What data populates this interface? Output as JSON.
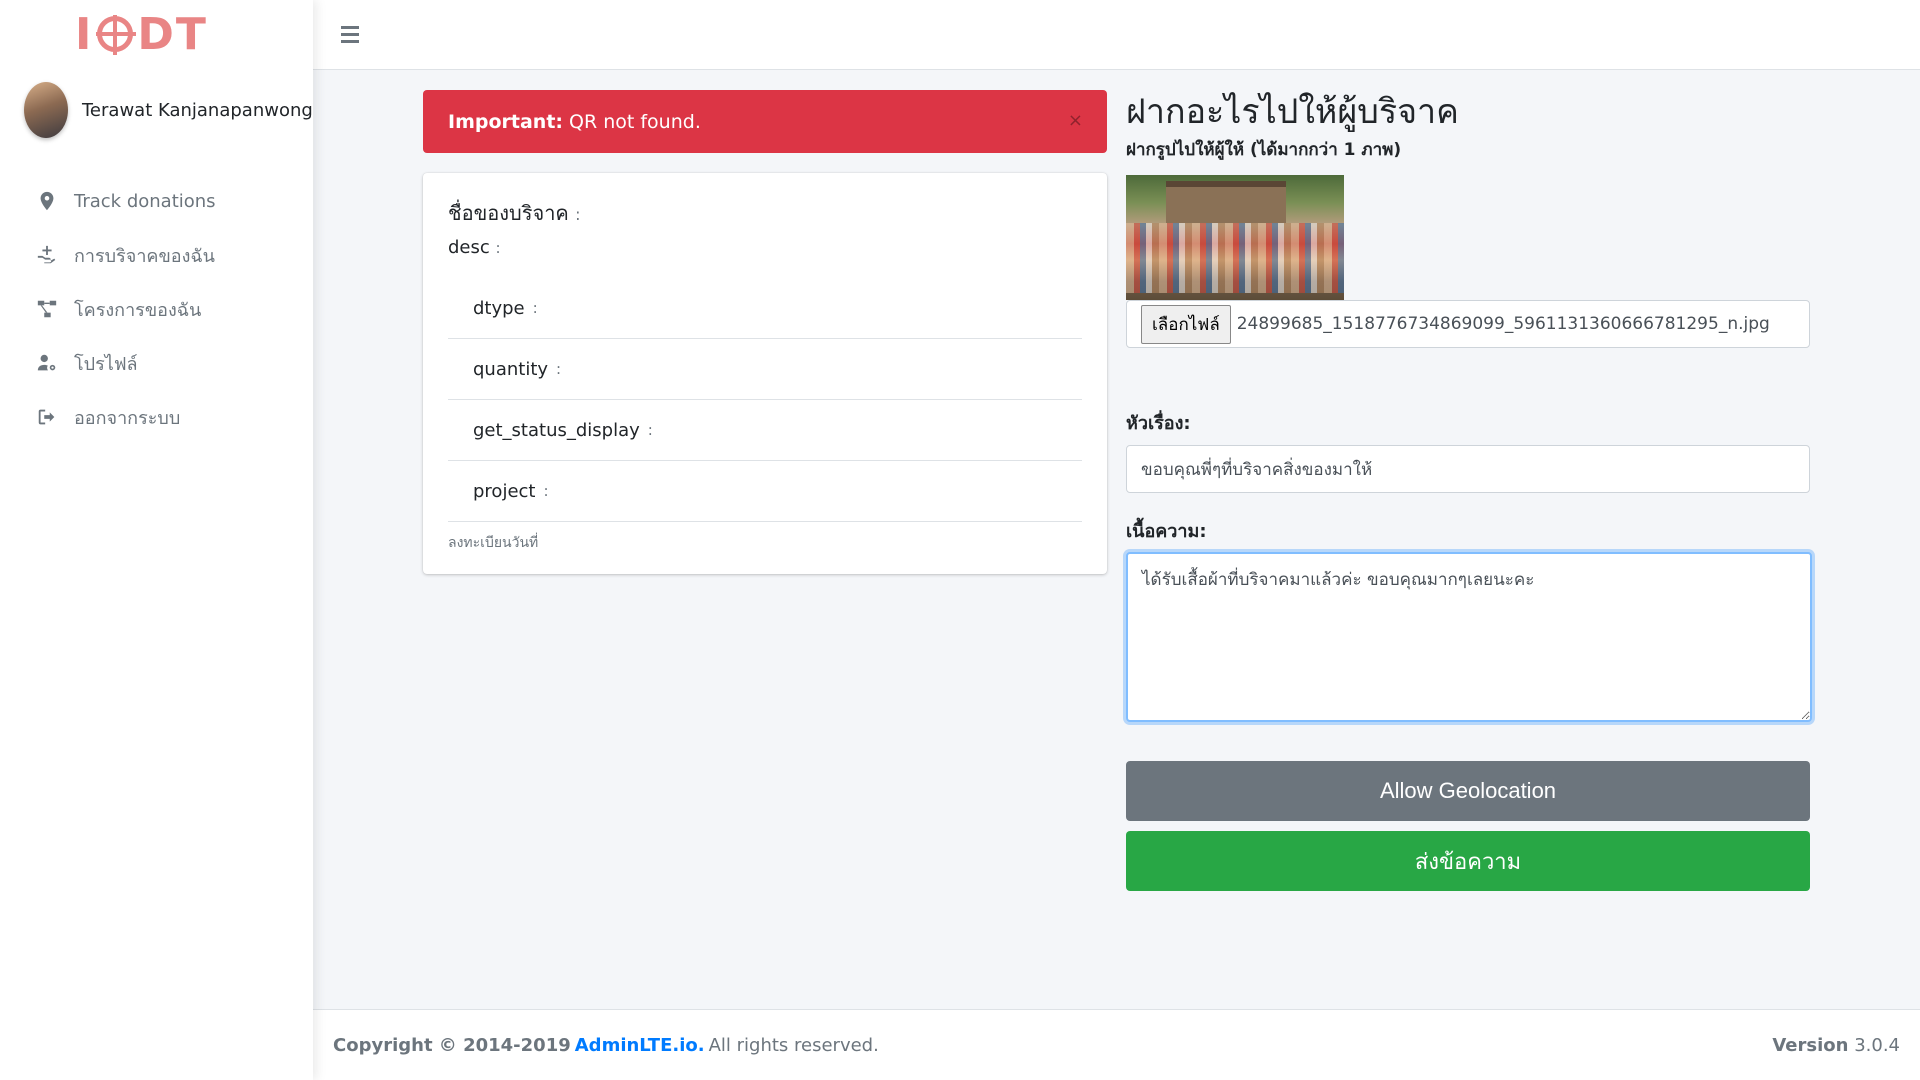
{
  "brand": {
    "left": "I",
    "right": "DT"
  },
  "user": {
    "name": "Terawat Kanjanapanwong"
  },
  "sidebar": {
    "items": [
      {
        "label": "Track donations",
        "icon": "map-marker-icon"
      },
      {
        "label": "การบริจาคของฉัน",
        "icon": "hand-donate-icon"
      },
      {
        "label": "โครงการของฉัน",
        "icon": "project-diagram-icon"
      },
      {
        "label": "โปรไฟล์",
        "icon": "user-cog-icon"
      },
      {
        "label": "ออกจากระบบ",
        "icon": "sign-out-icon"
      }
    ]
  },
  "alert": {
    "strong": "Important:",
    "text": "QR not found.",
    "close": "×"
  },
  "card": {
    "title": "ชื่อของบริจาค",
    "sep": ":",
    "desc_label": "desc",
    "rows": [
      {
        "label": "dtype"
      },
      {
        "label": "quantity"
      },
      {
        "label": "get_status_display"
      },
      {
        "label": "project"
      }
    ],
    "reg_date": "ลงทะเบียนวันที่"
  },
  "form": {
    "heading": "ฝากอะไรไปให้ผู้บริจาค",
    "subheading": "ฝากรูปไปให้ผู้ให้ (ได้มากกว่า 1 ภาพ)",
    "file_button": "เลือกไฟล์",
    "file_name": "24899685_1518776734869099_5961131360666781295_n.jpg",
    "subject_label": "หัวเรื่อง:",
    "subject_value": "ขอบคุณพี่ๆที่บริจาคสิ่งของมาให้",
    "body_label": "เนื้อความ:",
    "body_value": "ได้รับเสื้อผ้าที่บริจาคมาแล้วค่ะ ขอบคุณมากๆเลยนะคะ",
    "geo_button": "Allow Geolocation",
    "send_button": "ส่งข้อความ"
  },
  "footer": {
    "copyright": "Copyright © 2014-2019",
    "link": "AdminLTE.io.",
    "rights": "All rights reserved.",
    "version_label": "Version",
    "version_value": "3.0.4"
  }
}
